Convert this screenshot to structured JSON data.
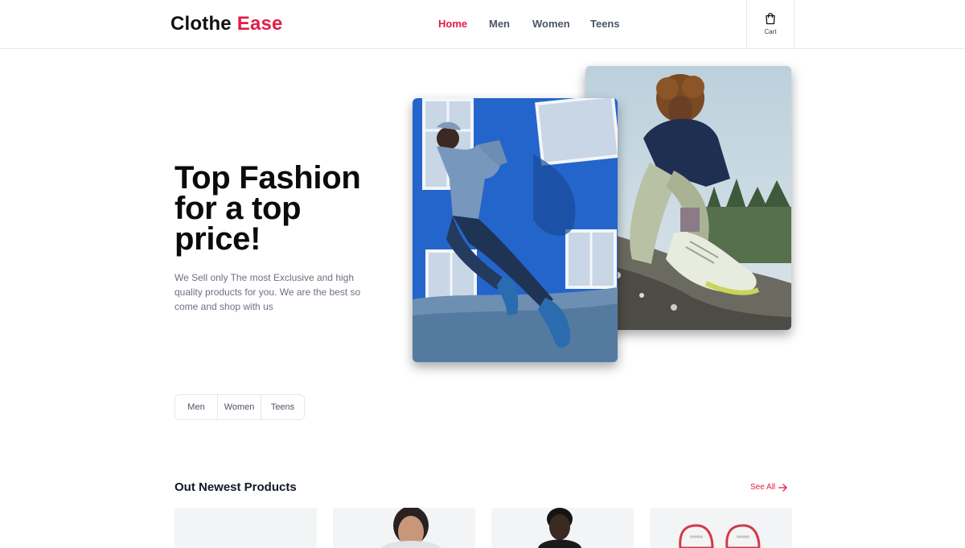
{
  "header": {
    "logo": {
      "part1": "Clothe",
      "part2": "Ease"
    },
    "nav": [
      {
        "label": "Home",
        "active": true
      },
      {
        "label": "Men",
        "active": false
      },
      {
        "label": "Women",
        "active": false
      },
      {
        "label": "Teens",
        "active": false
      }
    ],
    "cart": {
      "label": "Cart",
      "icon": "shopping-bag-icon"
    }
  },
  "hero": {
    "title": "Top Fashion for a top price!",
    "description": "We Sell only The most Exclusive and high quality products for you. We are the best so come and shop with us",
    "images": [
      "woman-sneakers-photo",
      "man-running-photo"
    ]
  },
  "category_filter": [
    "Men",
    "Women",
    "Teens"
  ],
  "products_section": {
    "title": "Out Newest Products",
    "see_all": "See All",
    "cards": [
      "empty-product",
      "woman-product",
      "man-jacket-product",
      "sneakers-product"
    ]
  },
  "colors": {
    "accent": "#e11d48",
    "text": "#111827",
    "muted": "#6b7280"
  }
}
